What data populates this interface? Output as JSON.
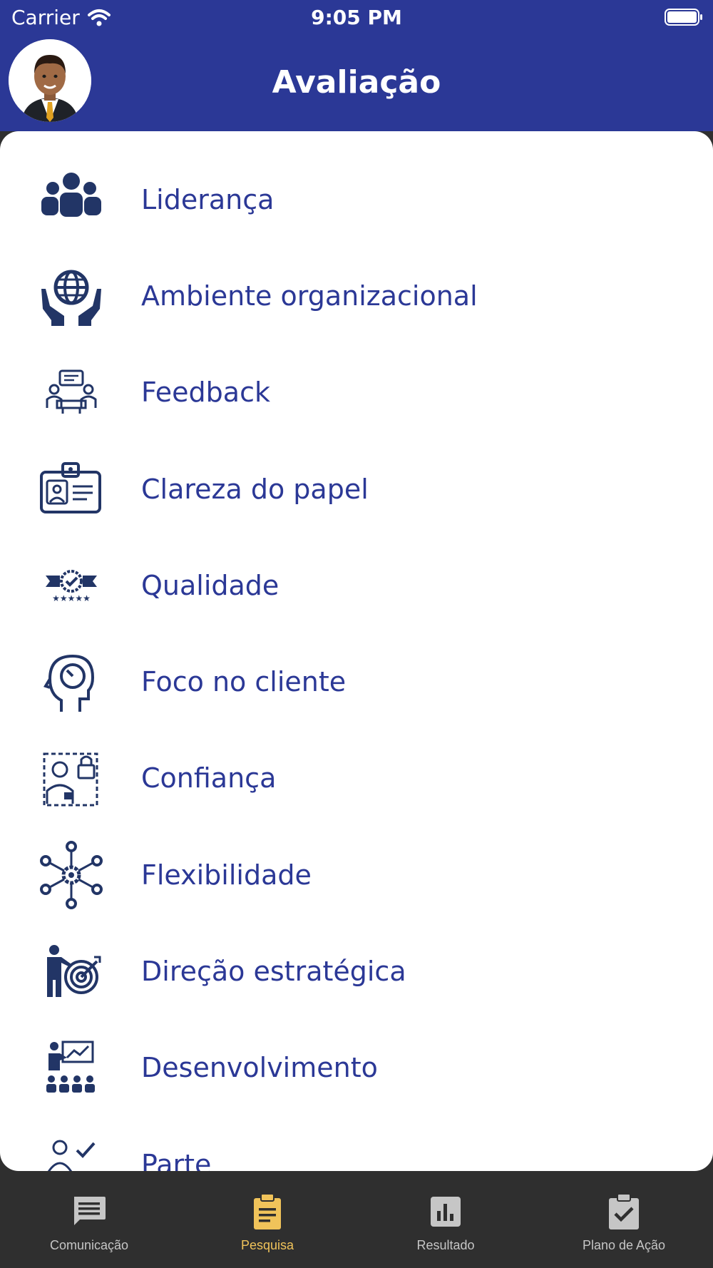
{
  "status_bar": {
    "carrier": "Carrier",
    "time": "9:05 PM"
  },
  "header": {
    "title": "Avaliação"
  },
  "colors": {
    "brand": "#2b3896",
    "tab_active": "#f0c35a",
    "tab_inactive": "#c6c6c6",
    "icon": "#223566"
  },
  "menu": {
    "items": [
      {
        "label": "Liderança",
        "icon": "team-icon"
      },
      {
        "label": "Ambiente organizacional",
        "icon": "globe-in-hands-icon"
      },
      {
        "label": "Feedback",
        "icon": "meeting-chat-icon"
      },
      {
        "label": "Clareza do papel",
        "icon": "id-badge-icon"
      },
      {
        "label": "Qualidade",
        "icon": "quality-badge-icon"
      },
      {
        "label": "Foco no cliente",
        "icon": "head-gauge-icon"
      },
      {
        "label": "Confiança",
        "icon": "person-lock-icon"
      },
      {
        "label": "Flexibilidade",
        "icon": "gear-network-icon"
      },
      {
        "label": "Direção estratégica",
        "icon": "person-target-icon"
      },
      {
        "label": "Desenvolvimento",
        "icon": "presentation-icon"
      },
      {
        "label": "Parte",
        "icon": "people-check-icon"
      }
    ]
  },
  "tabs": [
    {
      "label": "Comunicação",
      "icon": "message-icon",
      "active": false
    },
    {
      "label": "Pesquisa",
      "icon": "clipboard-icon",
      "active": true
    },
    {
      "label": "Resultado",
      "icon": "bar-chart-icon",
      "active": false
    },
    {
      "label": "Plano de Ação",
      "icon": "clipboard-check-icon",
      "active": false
    }
  ]
}
